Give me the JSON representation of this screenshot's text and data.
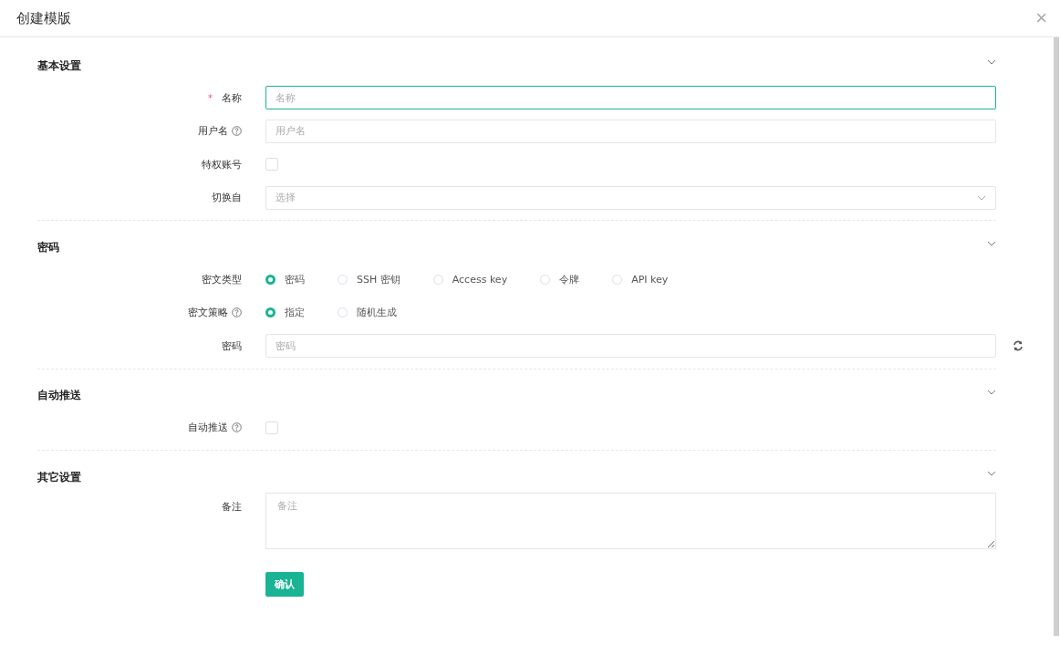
{
  "dialog": {
    "title": "创建模版",
    "close": "×"
  },
  "sections": [
    {
      "title": "基本设置",
      "expanded": true,
      "fields": [
        {
          "kind": "text",
          "label": "名称",
          "required_mark": "*",
          "help": false,
          "placeholder": "名称",
          "focused": true
        },
        {
          "kind": "text",
          "label": "用户名",
          "help": true,
          "placeholder": "用户名",
          "focused": false
        },
        {
          "kind": "checkbox",
          "label": "特权账号",
          "help": false,
          "checked": false
        },
        {
          "kind": "select",
          "label": "切换自",
          "help": false,
          "placeholder": "选择"
        }
      ]
    },
    {
      "title": "密码",
      "expanded": true,
      "fields": [
        {
          "kind": "radio",
          "label": "密文类型",
          "help": false,
          "options": [
            {
              "label": "密码",
              "selected": true
            },
            {
              "label": "SSH 密钥",
              "selected": false
            },
            {
              "label": "Access key",
              "selected": false
            },
            {
              "label": "令牌",
              "selected": false
            },
            {
              "label": "API key",
              "selected": false
            }
          ]
        },
        {
          "kind": "radio",
          "label": "密文策略",
          "help": true,
          "options": [
            {
              "label": "指定",
              "selected": true
            },
            {
              "label": "随机生成",
              "selected": false
            }
          ]
        },
        {
          "kind": "password",
          "label": "密码",
          "help": false,
          "placeholder": "密码"
        }
      ]
    },
    {
      "title": "自动推送",
      "expanded": true,
      "fields": [
        {
          "kind": "checkbox",
          "label": "自动推送",
          "help": true,
          "checked": false
        }
      ]
    },
    {
      "title": "其它设置",
      "expanded": true,
      "fields": [
        {
          "kind": "textarea",
          "label": "备注",
          "help": false,
          "placeholder": "备注"
        }
      ]
    }
  ],
  "submit": "确认"
}
